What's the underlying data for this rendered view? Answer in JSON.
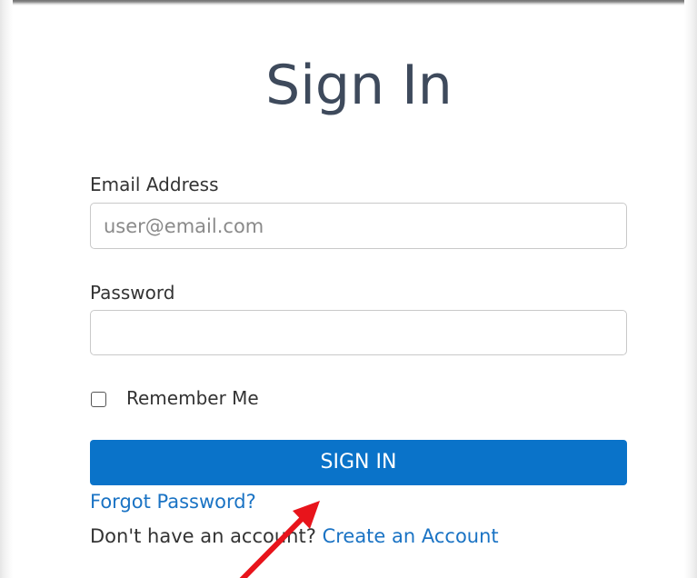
{
  "page": {
    "title": "Sign In"
  },
  "form": {
    "email": {
      "label": "Email Address",
      "placeholder": "user@email.com",
      "value": ""
    },
    "password": {
      "label": "Password",
      "value": ""
    },
    "remember": {
      "label": "Remember Me",
      "checked": false
    },
    "submit_label": "SIGN IN"
  },
  "links": {
    "forgot_password": "Forgot Password?",
    "no_account_prompt": "Don't have an account? ",
    "create_account": "Create an Account"
  },
  "colors": {
    "title": "#3e4a5c",
    "button_bg": "#0a73c9",
    "link": "#1a73c4",
    "annotation_arrow": "#e8141b"
  },
  "annotation": {
    "type": "arrow",
    "points_to": "forgot-password-link"
  }
}
